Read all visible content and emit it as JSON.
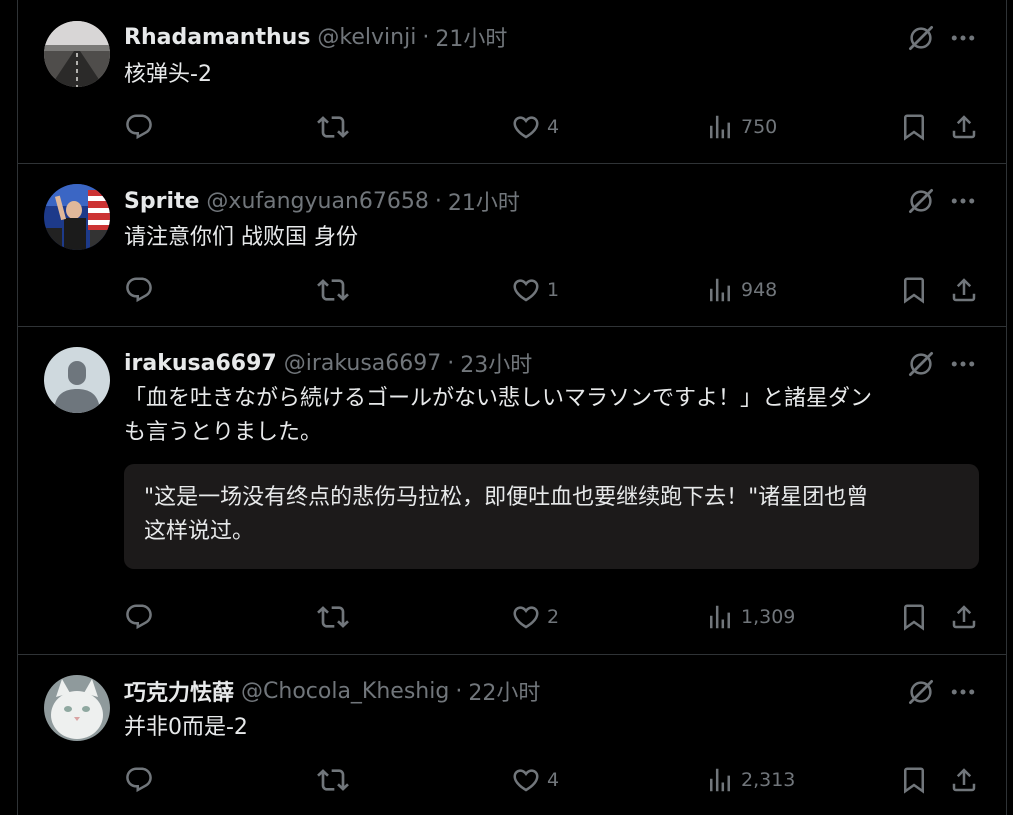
{
  "tweets": [
    {
      "name": "Rhadamanthus",
      "handle": "@kelvinji",
      "time": "21小时",
      "text": "核弹头-2",
      "likes": "4",
      "views": "750",
      "avatar_icon": "road-landscape-avatar"
    },
    {
      "name": "Sprite",
      "handle": "@xufangyuan67658",
      "time": "21小时",
      "text": "请注意你们 战败国 身份",
      "likes": "1",
      "views": "948",
      "avatar_icon": "photo-avatar"
    },
    {
      "name": "irakusa6697",
      "handle": "@irakusa6697",
      "time": "23小时",
      "text_line1": "「血を吐きながら続けるゴールがない悲しいマラソンですよ！」と諸星ダン",
      "text_line2": "も言うとりました。",
      "translation_line1": "\"这是一场没有终点的悲伤马拉松，即便吐血也要继续跑下去！\"诸星团也曾",
      "translation_line2": "这样说过。",
      "likes": "2",
      "views": "1,309",
      "avatar_icon": "default-person-avatar"
    },
    {
      "name": "巧克力怯薛",
      "handle": "@Chocola_Kheshig",
      "time": "22小时",
      "text": "并非0而是-2",
      "likes": "4",
      "views": "2,313",
      "avatar_icon": "white-cat-avatar"
    }
  ],
  "separator": "·",
  "icons": {
    "reply": "reply-icon",
    "retweet": "retweet-icon",
    "like": "heart-icon",
    "views": "views-chart-icon",
    "bookmark": "bookmark-icon",
    "share": "share-icon",
    "grok": "grok-icon",
    "more": "more-icon"
  },
  "colors": {
    "background": "#000000",
    "text": "#e7e9ea",
    "muted": "#71767b",
    "border": "#2f3336",
    "quote_bg": "#1c1a1a"
  }
}
